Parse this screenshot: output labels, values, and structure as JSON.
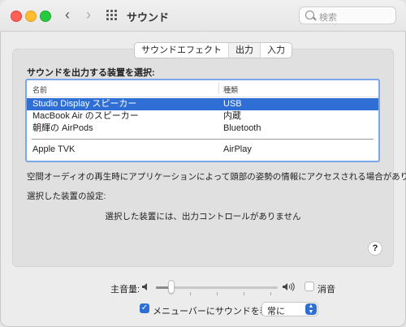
{
  "window": {
    "title": "サウンド",
    "search_placeholder": "検索"
  },
  "tabs": [
    {
      "label": "サウンドエフェクト",
      "active": false
    },
    {
      "label": "出力",
      "active": true
    },
    {
      "label": "入力",
      "active": false
    }
  ],
  "output": {
    "heading": "サウンドを出力する装置を選択:",
    "columns": {
      "name": "名前",
      "type": "種類"
    },
    "devices": [
      {
        "name": "Studio Display スピーカー",
        "type": "USB",
        "selected": true
      },
      {
        "name": "MacBook Air のスピーカー",
        "type": "内蔵",
        "selected": false
      },
      {
        "name": "朝輝の AirPods",
        "type": "Bluetooth",
        "selected": false
      },
      {
        "name": "Apple TVK",
        "type": "AirPlay",
        "selected": false
      }
    ],
    "spatial_note": "空間オーディオの再生時にアプリケーションによって頭部の姿勢の情報にアクセスされる場合があります。",
    "settings_label": "選択した装置の設定:",
    "no_controls": "選択した装置には、出力コントロールがありません"
  },
  "help_label": "?",
  "volume": {
    "label": "主音量:",
    "level": 0.13,
    "mute_label": "消音",
    "muted": false
  },
  "menubar": {
    "label": "メニューバーにサウンドを表示",
    "checked": true,
    "select_value": "常に"
  },
  "colors": {
    "accent": "#2f6ed4",
    "close": "#fe5f57",
    "minimize": "#febc2e",
    "zoom": "#28c840"
  }
}
